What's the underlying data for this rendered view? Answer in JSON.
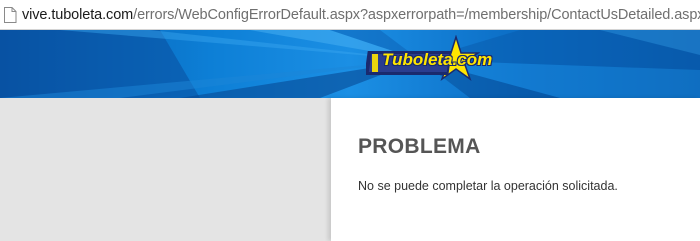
{
  "address_bar": {
    "domain": "vive.tuboleta.com",
    "path": "/errors/WebConfigErrorDefault.aspx?aspxerrorpath=/membership/ContactUsDetailed.aspx",
    "page_icon": "document-icon"
  },
  "banner": {
    "logo_text": "Tuboleta.com",
    "background_color": "#0a6fc9",
    "logo_color": "#ffe600"
  },
  "error": {
    "title": "PROBLEMA",
    "message": "No se puede completar la operación solicitada."
  }
}
